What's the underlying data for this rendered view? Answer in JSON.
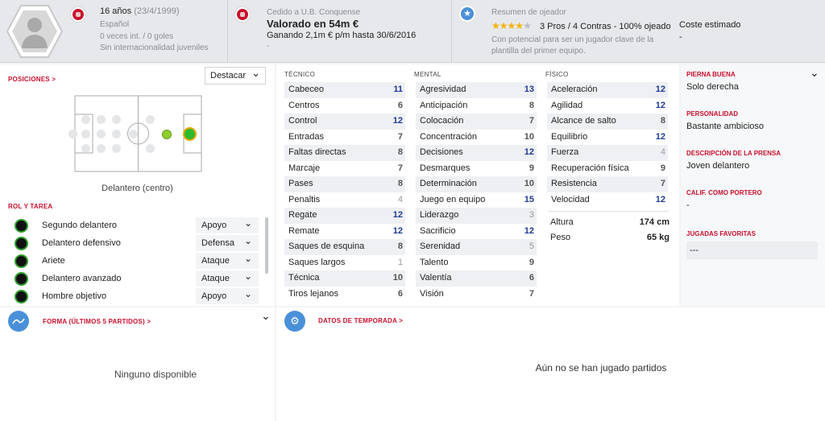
{
  "header": {
    "age": "16 años",
    "dob": "(23/4/1999)",
    "nationality": "Español",
    "caps": "0 veces int. / 0 goles",
    "youth_caps": "Sin internacionalidad juveniles",
    "loan": "Cedido a U.B. Conquense",
    "value": "Valorado en 54m €",
    "wage": "Ganando 2,1m € p/m hasta 30/6/2016",
    "wage_extra": "-",
    "scout_title": "Resumen de ojeador",
    "stars_filled": 4,
    "stars_total": 5,
    "scout_summary": "3 Pros / 4 Contras - 100% ojeado",
    "scout_text": "Con potencial para ser un jugador clave de la plantilla del primer equipo.",
    "cost_label": "Coste estimado",
    "cost_value": "-"
  },
  "positions": {
    "title": "POSICIONES",
    "highlight_select": "Destacar",
    "position_name": "Delantero (centro)"
  },
  "role": {
    "title": "ROL Y TAREA",
    "items": [
      {
        "name": "Segundo delantero",
        "duty": "Apoyo"
      },
      {
        "name": "Delantero defensivo",
        "duty": "Defensa"
      },
      {
        "name": "Ariete",
        "duty": "Ataque"
      },
      {
        "name": "Delantero avanzado",
        "duty": "Ataque"
      },
      {
        "name": "Hombre objetivo",
        "duty": "Apoyo"
      }
    ]
  },
  "attributes": {
    "tecnico_title": "TÉCNICO",
    "mental_title": "MENTAL",
    "fisico_title": "FÍSICO",
    "tecnico": [
      {
        "n": "Cabeceo",
        "v": "11"
      },
      {
        "n": "Centros",
        "v": "6"
      },
      {
        "n": "Control",
        "v": "12"
      },
      {
        "n": "Entradas",
        "v": "7"
      },
      {
        "n": "Faltas directas",
        "v": "8"
      },
      {
        "n": "Marcaje",
        "v": "7"
      },
      {
        "n": "Pases",
        "v": "8"
      },
      {
        "n": "Penaltis",
        "v": "4"
      },
      {
        "n": "Regate",
        "v": "12"
      },
      {
        "n": "Remate",
        "v": "12"
      },
      {
        "n": "Saques de esquina",
        "v": "8"
      },
      {
        "n": "Saques largos",
        "v": "1"
      },
      {
        "n": "Técnica",
        "v": "10"
      },
      {
        "n": "Tiros lejanos",
        "v": "6"
      }
    ],
    "mental": [
      {
        "n": "Agresividad",
        "v": "13"
      },
      {
        "n": "Anticipación",
        "v": "8"
      },
      {
        "n": "Colocación",
        "v": "7"
      },
      {
        "n": "Concentración",
        "v": "10"
      },
      {
        "n": "Decisiones",
        "v": "12"
      },
      {
        "n": "Desmarques",
        "v": "9"
      },
      {
        "n": "Determinación",
        "v": "10"
      },
      {
        "n": "Juego en equipo",
        "v": "15"
      },
      {
        "n": "Liderazgo",
        "v": "3"
      },
      {
        "n": "Sacrificio",
        "v": "12"
      },
      {
        "n": "Serenidad",
        "v": "5"
      },
      {
        "n": "Talento",
        "v": "9"
      },
      {
        "n": "Valentía",
        "v": "6"
      },
      {
        "n": "Visión",
        "v": "7"
      }
    ],
    "fisico": [
      {
        "n": "Aceleración",
        "v": "12"
      },
      {
        "n": "Agilidad",
        "v": "12"
      },
      {
        "n": "Alcance de salto",
        "v": "8"
      },
      {
        "n": "Equilibrio",
        "v": "12"
      },
      {
        "n": "Fuerza",
        "v": "4"
      },
      {
        "n": "Recuperación física",
        "v": "9"
      },
      {
        "n": "Resistencia",
        "v": "7"
      },
      {
        "n": "Velocidad",
        "v": "12"
      }
    ],
    "height_label": "Altura",
    "height_value": "174 cm",
    "weight_label": "Peso",
    "weight_value": "65 kg"
  },
  "profile": {
    "foot_title": "PIERNA BUENA",
    "foot_value": "Solo derecha",
    "personality_title": "PERSONALIDAD",
    "personality_value": "Bastante ambicioso",
    "press_title": "DESCRIPCIÓN DE LA PRENSA",
    "press_value": "Joven delantero",
    "gk_title": "CALIF. COMO PORTERO",
    "gk_value": "-",
    "plays_title": "JUGADAS FAVORITAS",
    "plays_value": "---"
  },
  "form": {
    "title": "FORMA (ÚLTIMOS 5 PARTIDOS)",
    "empty": "Ninguno disponible"
  },
  "season": {
    "title": "DATOS DE TEMPORADA",
    "empty": "Aún no se han jugado partidos"
  },
  "colors": {
    "accent": "#c8102e",
    "high_value": "#1f3a93",
    "role_ring": "#2f9d2f",
    "star": "#f2b300",
    "scout_badge": "#4a90d9"
  }
}
